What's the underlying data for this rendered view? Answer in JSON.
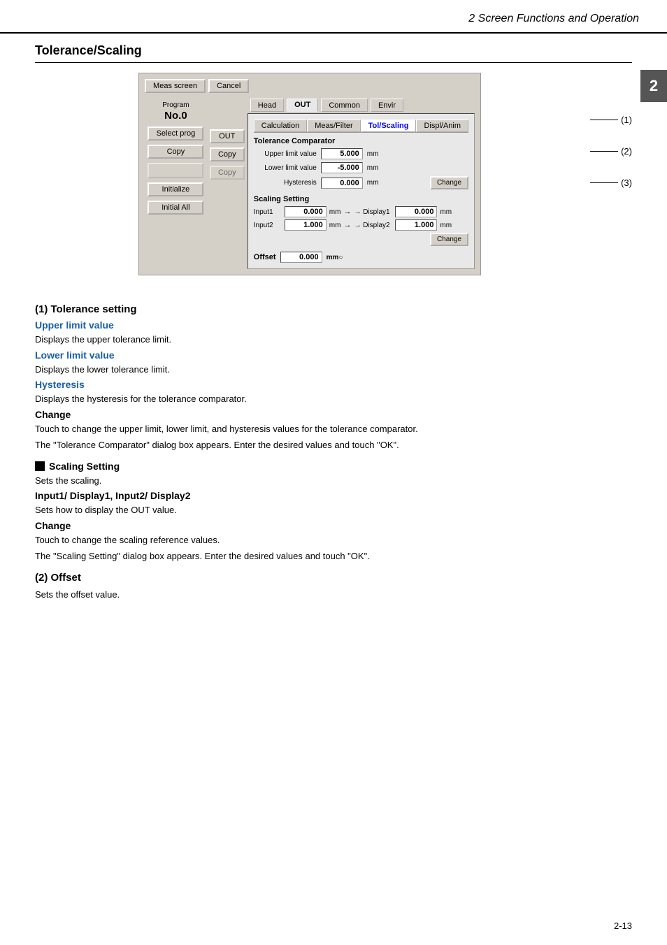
{
  "header": {
    "title": "2  Screen Functions and Operation"
  },
  "chapter": "2",
  "section": {
    "title": "Tolerance/Scaling"
  },
  "ui": {
    "top_buttons": [
      "Meas screen",
      "Cancel"
    ],
    "program_label": "Program",
    "program_number": "No.0",
    "sidebar_buttons": [
      "Select prog",
      "Copy",
      "",
      "Initialize",
      "Initial All"
    ],
    "mid_buttons": [
      "OUT",
      "Copy",
      "Copy"
    ],
    "tabs_outer": [
      "Head",
      "OUT",
      "Common",
      "Envir"
    ],
    "tabs_active": "OUT",
    "subtabs": [
      "Calculation",
      "Meas/Filter",
      "Tol/Scaling",
      "Displ/Anim"
    ],
    "subtab_active": "Tol/Scaling",
    "tolerance_section": {
      "label": "Tolerance Comparator",
      "upper_label": "Upper limit value",
      "upper_value": "5.000",
      "lower_label": "Lower limit value",
      "lower_value": "-5.000",
      "hysteresis_label": "Hysteresis",
      "hysteresis_value": "0.000",
      "unit": "mm",
      "change_btn": "Change"
    },
    "scaling_section": {
      "label": "Scaling Setting",
      "input1_label": "Input1",
      "input1_value": "0.000",
      "input1_unit": "mm",
      "display1_label": "→ Display1",
      "display1_value": "0.000",
      "display1_unit": "mm",
      "input2_label": "Input2",
      "input2_value": "1.000",
      "input2_unit": "mm",
      "display2_label": "→ Display2",
      "display2_value": "1.000",
      "display2_unit": "mm",
      "change_btn": "Change"
    },
    "offset_section": {
      "label": "Offset",
      "value": "0.000",
      "unit": "mm"
    },
    "callouts": [
      "(1)",
      "(2)",
      "(3)"
    ]
  },
  "descriptions": {
    "h2_1": "(1) Tolerance setting",
    "upper_limit": {
      "h3": "Upper limit value",
      "text": "Displays the upper tolerance limit."
    },
    "lower_limit": {
      "h3": "Lower limit value",
      "text": "Displays the lower tolerance limit."
    },
    "hysteresis": {
      "h3": "Hysteresis",
      "text": "Displays the hysteresis for the tolerance comparator."
    },
    "change1": {
      "h3": "Change",
      "text1": "Touch to change the upper limit, lower limit, and hysteresis values for the tolerance comparator.",
      "text2": "The \"Tolerance Comparator\" dialog box appears. Enter the desired values and touch \"OK\"."
    },
    "scaling_setting": {
      "h3": "Scaling Setting",
      "text": "Sets the scaling."
    },
    "input_display": {
      "h3": "Input1/ Display1, Input2/ Display2",
      "text": "Sets how to display the OUT value."
    },
    "change2": {
      "h3": "Change",
      "text1": "Touch to change the scaling reference values.",
      "text2": "The \"Scaling Setting\" dialog box appears. Enter the desired values and touch \"OK\"."
    },
    "h2_2": "(2) Offset",
    "offset_desc": "Sets the offset value."
  },
  "footer": {
    "page": "2-13"
  }
}
